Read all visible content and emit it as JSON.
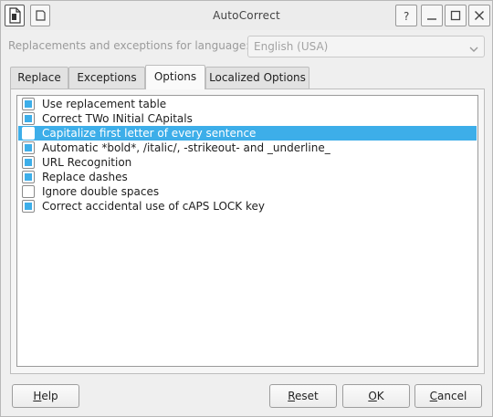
{
  "window": {
    "title": "AutoCorrect",
    "controls": {
      "help": "?",
      "minimize": "minimize",
      "maximize": "maximize",
      "close": "close"
    }
  },
  "language": {
    "label": "Replacements and exceptions for language:",
    "selected": "English (USA)"
  },
  "tabs": [
    {
      "label": "Replace",
      "active": false
    },
    {
      "label": "Exceptions",
      "active": false
    },
    {
      "label": "Options",
      "active": true
    },
    {
      "label": "Localized Options",
      "active": false
    }
  ],
  "options": [
    {
      "label": "Use replacement table",
      "checked": true,
      "selected": false
    },
    {
      "label": "Correct TWo INitial CApitals",
      "checked": true,
      "selected": false
    },
    {
      "label": "Capitalize first letter of every sentence",
      "checked": false,
      "selected": true
    },
    {
      "label": "Automatic *bold*, /italic/, -strikeout- and _underline_",
      "checked": true,
      "selected": false
    },
    {
      "label": "URL Recognition",
      "checked": true,
      "selected": false
    },
    {
      "label": "Replace dashes",
      "checked": true,
      "selected": false
    },
    {
      "label": "Ignore double spaces",
      "checked": false,
      "selected": false
    },
    {
      "label": "Correct accidental use of cAPS LOCK key",
      "checked": true,
      "selected": false
    }
  ],
  "buttons": {
    "help": "Help",
    "reset": "Reset",
    "ok": "OK",
    "cancel": "Cancel"
  },
  "colors": {
    "accent": "#3daee9",
    "selection_text": "#ffffff"
  },
  "icons": {
    "app": "document-icon",
    "sticky": "pin-icon",
    "help": "help-icon",
    "minimize": "minimize-icon",
    "maximize": "maximize-icon",
    "close": "close-icon",
    "dropdown": "chevron-down-icon"
  }
}
